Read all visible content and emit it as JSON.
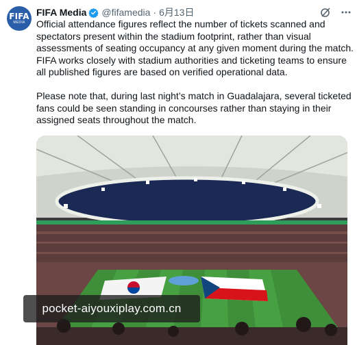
{
  "tweet": {
    "avatar": {
      "text_top": "FIFA",
      "text_bottom": "MEDIA",
      "color": "#2a5ea8"
    },
    "author_name": "FIFA Media",
    "handle": "@fifamedia",
    "separator": "·",
    "date": "6月13日",
    "verified_badge_color": "#1d9bf0",
    "icons": [
      "grok-icon",
      "more-options-icon"
    ],
    "paragraph1_lines": [
      "Official attendance figures reflect the number of tickets scanned and",
      "spectators present within the stadium footprint, rather than visual",
      "assessments of seating occupancy at any given moment during the match.",
      "FIFA works closely with stadium authorities and ticketing teams to ensure",
      "all published figures are based on verified operational data."
    ],
    "paragraph2_lines": [
      "Please note that, during last night’s match in Guadalajara, several ticketed",
      "fans could be seen standing in concourses rather than staying in their",
      "assigned seats throughout the match."
    ]
  },
  "media": {
    "description_icon": "stadium-photo",
    "pitch_color": "#3f8f3a",
    "roof_color": "#d9dcd6",
    "sky_color": "#1a2a55"
  },
  "watermark": {
    "text": "pocket-aiyouxiplay.com.cn"
  }
}
